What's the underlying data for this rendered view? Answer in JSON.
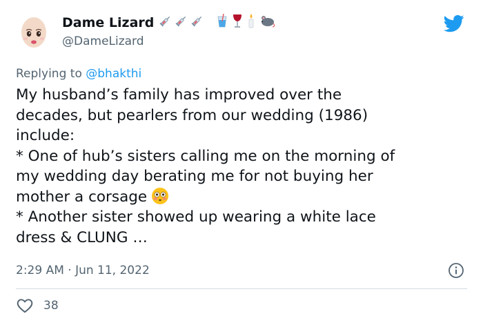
{
  "tweet": {
    "display_name": "Dame Lizard",
    "handle": "@DameLizard",
    "name_emojis": [
      "syringe-icon",
      "syringe-icon",
      "syringe-icon",
      "drink-cup-icon",
      "wine-glass-icon",
      "candle-icon",
      "mouse-icon"
    ],
    "replying_prefix": "Replying to ",
    "replying_to": "@bhakthi",
    "body_lines": [
      "My husband’s family has improved over the",
      "decades, but pearlers from our wedding (1986)",
      "include:",
      "* One of hub’s sisters calling me on the morning of",
      "my wedding day berating me for not buying her",
      "mother a corsage",
      "* Another sister showed up wearing a white lace",
      "dress & CLUNG …"
    ],
    "timestamp": "2:29 AM · Jun 11, 2022",
    "like_count": "38"
  },
  "colors": {
    "brand": "#1d9bf0",
    "text": "#0f1419",
    "secondary_text": "#536471",
    "divider": "#cfd9de"
  }
}
